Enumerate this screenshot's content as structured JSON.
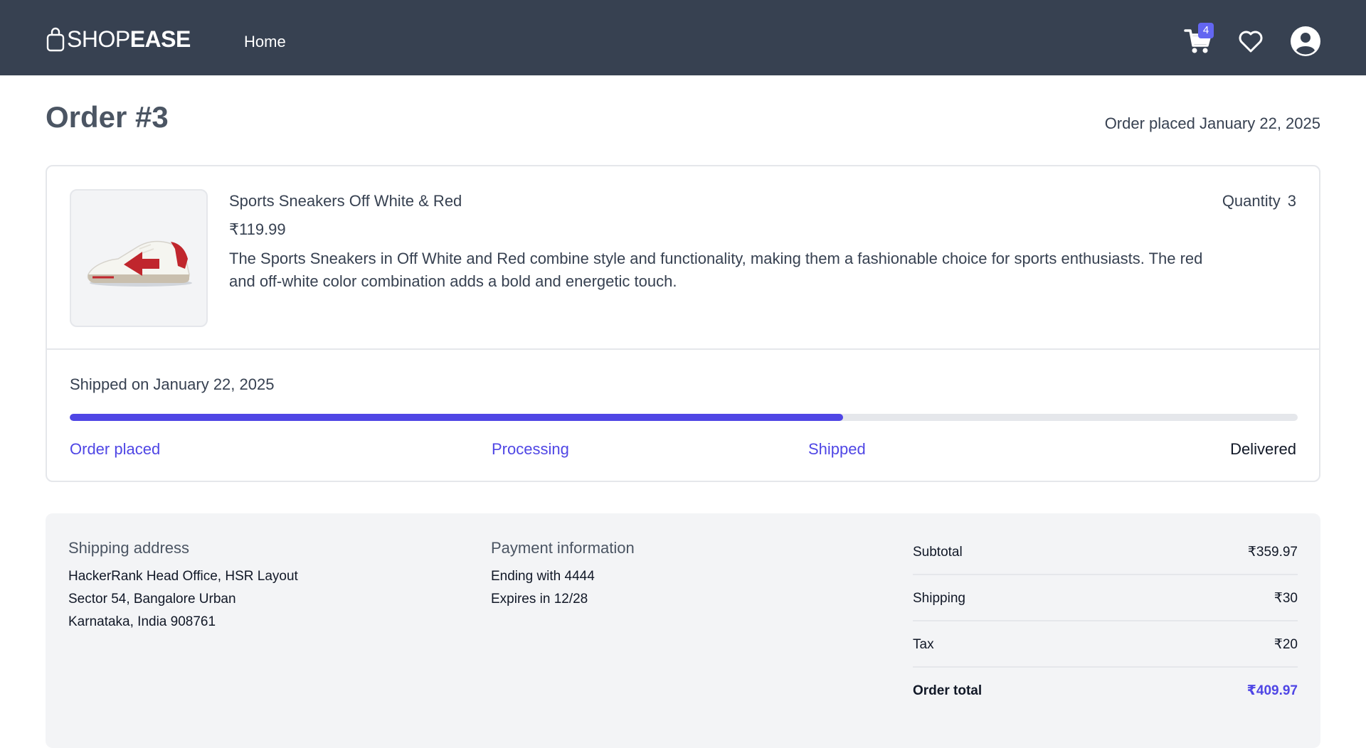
{
  "navbar": {
    "logo_light": "SHOP",
    "logo_bold": "EASE",
    "home": "Home",
    "cart_count": "4"
  },
  "order": {
    "title": "Order #3",
    "placed": "Order placed January 22, 2025"
  },
  "product": {
    "name": "Sports Sneakers Off White & Red",
    "price": "₹119.99",
    "description": "The Sports Sneakers in Off White and Red combine style and functionality, making them a fashionable choice for sports enthusiasts. The red and off-white color combination adds a bold and energetic touch.",
    "quantity_label": "Quantity",
    "quantity": "3",
    "image_alt": "Sports Sneakers Off White & Red"
  },
  "shipment": {
    "status": "Shipped on January 22, 2025",
    "progress_percent": 63,
    "steps": [
      "Order placed",
      "Processing",
      "Shipped",
      "Delivered"
    ]
  },
  "shipping": {
    "heading": "Shipping address",
    "lines": [
      "HackerRank Head Office, HSR Layout",
      "Sector 54, Bangalore Urban",
      "Karnataka, India 908761"
    ]
  },
  "payment": {
    "heading": "Payment information",
    "lines": [
      "Ending with 4444",
      "Expires in 12/28"
    ]
  },
  "totals": {
    "subtotal_label": "Subtotal",
    "subtotal": "₹359.97",
    "shipping_label": "Shipping",
    "shipping": "₹30",
    "tax_label": "Tax",
    "tax": "₹20",
    "total_label": "Order total",
    "total": "₹409.97"
  },
  "colors": {
    "navbar": "#374151",
    "accent": "#4f46e5",
    "badge": "#6366f1"
  }
}
